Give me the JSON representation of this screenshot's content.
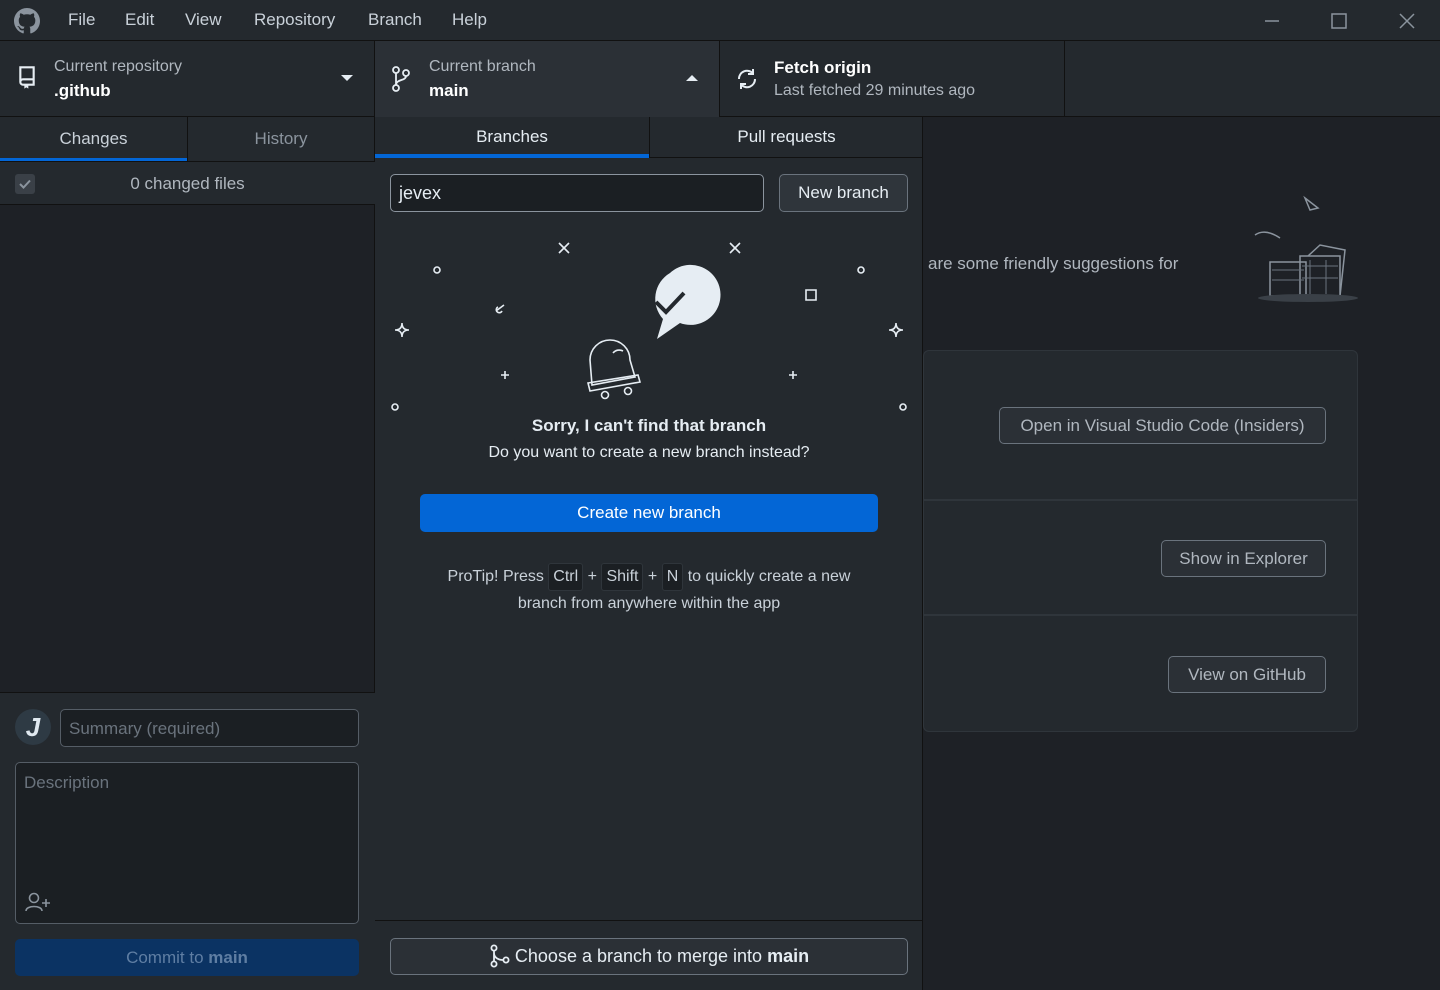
{
  "menu": [
    "File",
    "Edit",
    "View",
    "Repository",
    "Branch",
    "Help"
  ],
  "toolbar": {
    "repo_label": "Current repository",
    "repo_value": ".github",
    "branch_label": "Current branch",
    "branch_value": "main",
    "fetch_label": "Fetch origin",
    "fetch_sub": "Last fetched 29 minutes ago"
  },
  "left": {
    "tab_changes": "Changes",
    "tab_history": "History",
    "changed_files": "0 changed files",
    "summary_placeholder": "Summary (required)",
    "description_placeholder": "Description",
    "commit_prefix": "Commit to ",
    "commit_branch": "main"
  },
  "dropdown": {
    "tab_branches": "Branches",
    "tab_pulls": "Pull requests",
    "filter_value": "jevex",
    "new_branch": "New branch",
    "sorry_title": "Sorry, I can't find that branch",
    "sorry_sub": "Do you want to create a new branch instead?",
    "create_btn": "Create new branch",
    "protip_1": "ProTip! Press",
    "key_ctrl": "Ctrl",
    "plus": "+",
    "key_shift": "Shift",
    "key_n": "N",
    "protip_2": "to quickly create a new",
    "protip_3": "branch from anywhere within the app",
    "merge_prefix": "Choose a branch to merge into ",
    "merge_branch": "main"
  },
  "right": {
    "suggest_text": "are some friendly suggestions for",
    "btn_vscode": "Open in Visual Studio Code (Insiders)",
    "btn_explorer": "Show in Explorer",
    "btn_github": "View on GitHub"
  },
  "colors": {
    "accent": "#0366d6",
    "bg": "#1e2126",
    "panel": "#24292e"
  }
}
